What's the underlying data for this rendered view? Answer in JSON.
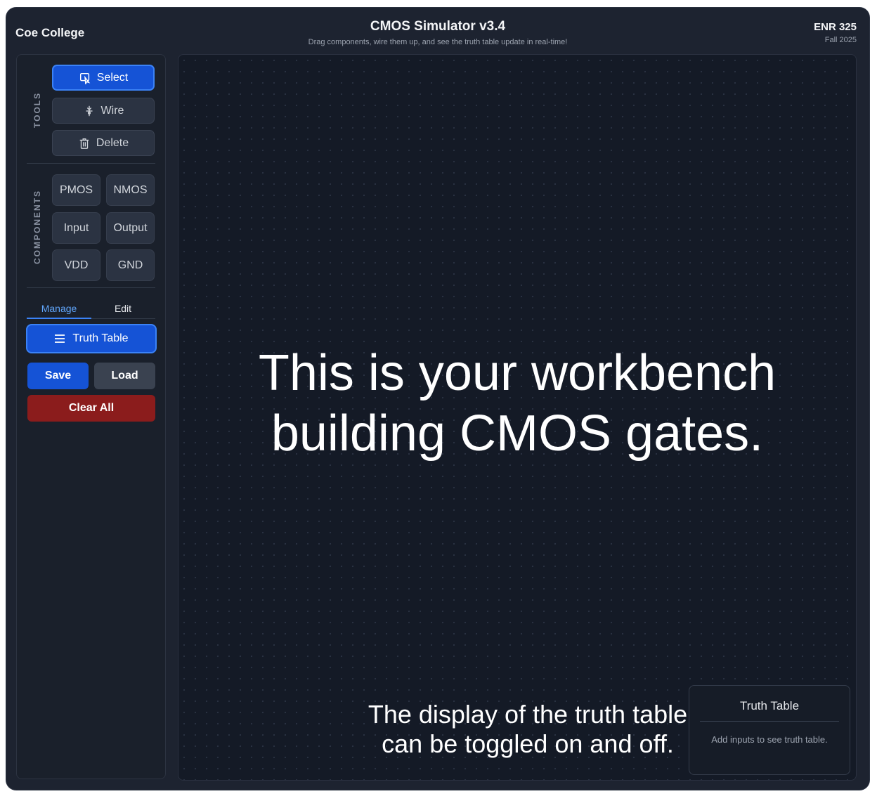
{
  "header": {
    "brand": "Coe College",
    "title": "CMOS Simulator v3.4",
    "subtitle": "Drag components, wire them up, and see the truth table update in real-time!",
    "course_code": "ENR 325",
    "course_term": "Fall 2025"
  },
  "sidebar": {
    "tools_label": "TOOLS",
    "tools": [
      {
        "label": "Select",
        "icon": "select-icon",
        "active": true
      },
      {
        "label": "Wire",
        "icon": "wire-icon",
        "active": false
      },
      {
        "label": "Delete",
        "icon": "trash-icon",
        "active": false
      }
    ],
    "components_label": "COMPONENTS",
    "components": [
      "PMOS",
      "NMOS",
      "Input",
      "Output",
      "VDD",
      "GND"
    ],
    "tabs": [
      {
        "label": "Manage",
        "active": true
      },
      {
        "label": "Edit",
        "active": false
      }
    ],
    "truth_table_button": "Truth Table",
    "save_button": "Save",
    "load_button": "Load",
    "clear_button": "Clear All"
  },
  "canvas": {
    "annotation_main_line1": "This is your workbench",
    "annotation_main_line2": "building CMOS gates.",
    "annotation_toggle_line1": "The display of the truth table",
    "annotation_toggle_line2": "can be toggled on and off."
  },
  "truth_table_panel": {
    "title": "Truth Table",
    "empty_message": "Add inputs to see truth table."
  },
  "colors": {
    "accent": "#1553d6",
    "danger": "#8b1c1c",
    "background": "#1d2330",
    "canvas": "#141a26"
  }
}
